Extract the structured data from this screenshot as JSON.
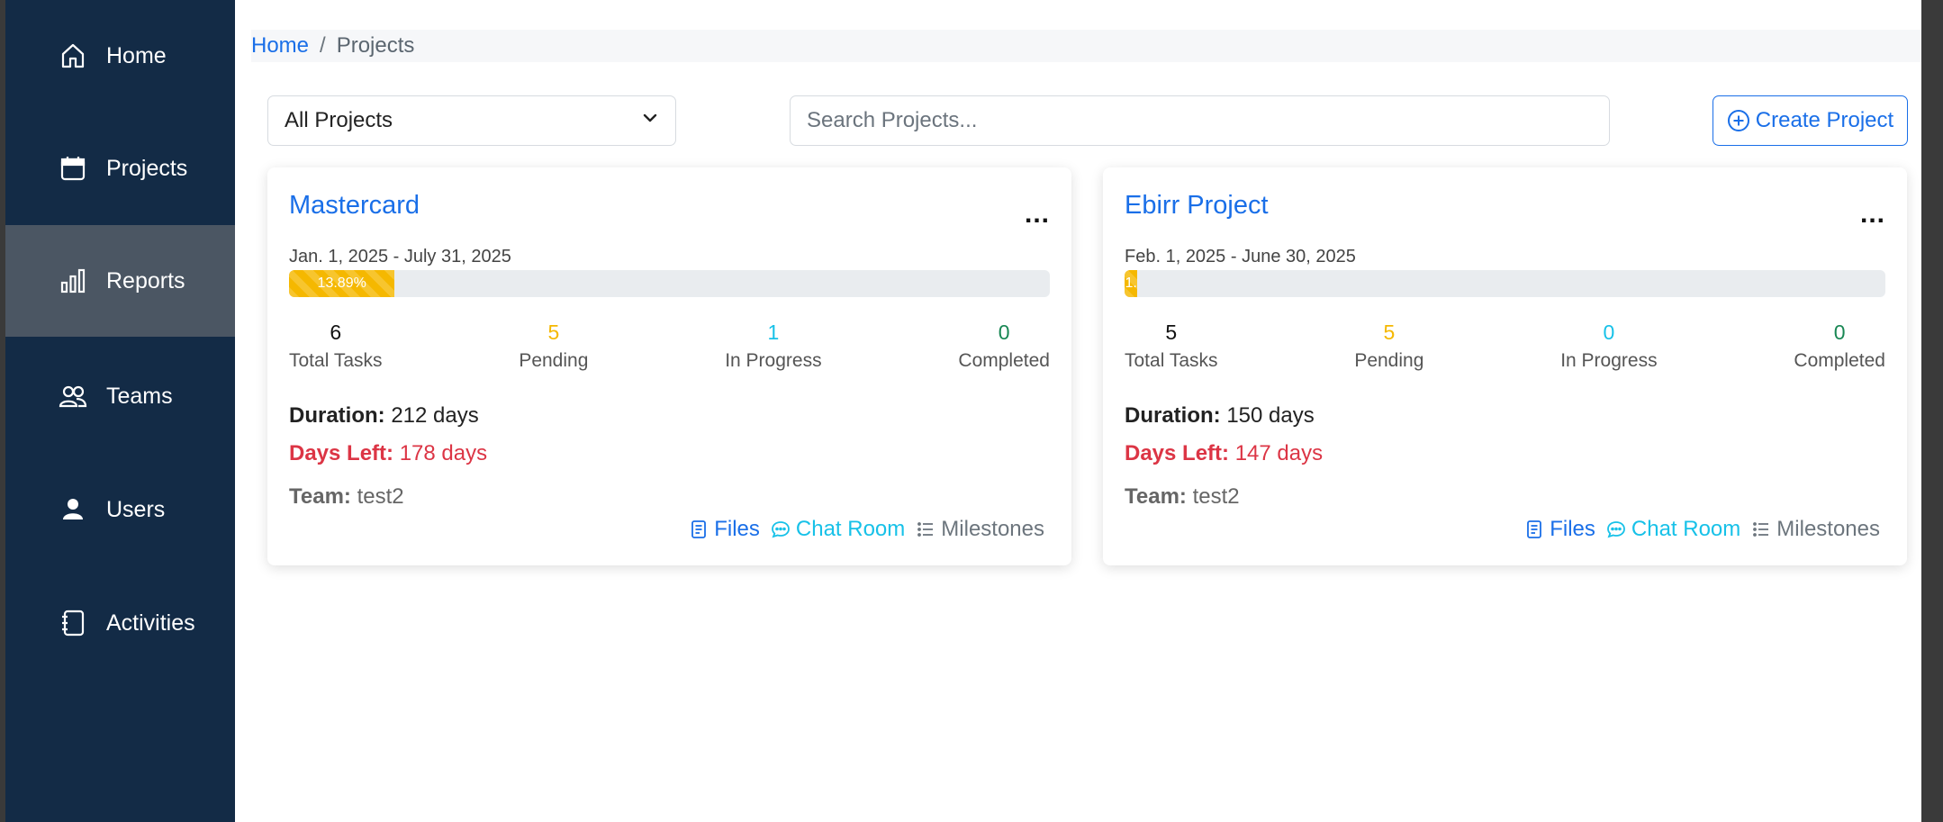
{
  "colors": {
    "sidebar": "#132b46",
    "sidebar_active": "#4b5663",
    "primary": "#1a6fe8",
    "pending": "#f5b800",
    "in_progress": "#17c1e8",
    "completed": "#198754",
    "danger": "#dc3545"
  },
  "sidebar": {
    "items": [
      {
        "label": "Home",
        "icon": "home-icon"
      },
      {
        "label": "Projects",
        "icon": "calendar-icon"
      },
      {
        "label": "Reports",
        "icon": "bar-chart-icon",
        "active": true
      },
      {
        "label": "Teams",
        "icon": "people-icon"
      },
      {
        "label": "Users",
        "icon": "person-icon"
      },
      {
        "label": "Activities",
        "icon": "journal-icon"
      }
    ]
  },
  "breadcrumb": {
    "home": "Home",
    "separator": "/",
    "current": "Projects"
  },
  "filter": {
    "selected": "All Projects"
  },
  "search": {
    "placeholder": "Search Projects...",
    "value": ""
  },
  "create_button": {
    "label": "Create Project"
  },
  "projects": [
    {
      "title": "Mastercard",
      "menu": "...",
      "dates": "Jan. 1, 2025 - July 31, 2025",
      "progress_label": "13.89%",
      "progress_percent": 13.89,
      "stats": {
        "total": {
          "value": "6",
          "label": "Total Tasks"
        },
        "pending": {
          "value": "5",
          "label": "Pending"
        },
        "in_progress": {
          "value": "1",
          "label": "In Progress"
        },
        "completed": {
          "value": "0",
          "label": "Completed"
        }
      },
      "duration_label": "Duration:",
      "duration": "212 days",
      "days_left_label": "Days Left:",
      "days_left": "178 days",
      "team_label": "Team:",
      "team": "test2",
      "links": {
        "files": "Files",
        "chat": "Chat Room",
        "milestones": "Milestones"
      }
    },
    {
      "title": "Ebirr Project",
      "menu": "...",
      "dates": "Feb. 1, 2025 - June 30, 2025",
      "progress_label": "1.",
      "progress_percent": 1.7,
      "stats": {
        "total": {
          "value": "5",
          "label": "Total Tasks"
        },
        "pending": {
          "value": "5",
          "label": "Pending"
        },
        "in_progress": {
          "value": "0",
          "label": "In Progress"
        },
        "completed": {
          "value": "0",
          "label": "Completed"
        }
      },
      "duration_label": "Duration:",
      "duration": "150 days",
      "days_left_label": "Days Left:",
      "days_left": "147 days",
      "team_label": "Team:",
      "team": "test2",
      "links": {
        "files": "Files",
        "chat": "Chat Room",
        "milestones": "Milestones"
      }
    }
  ]
}
